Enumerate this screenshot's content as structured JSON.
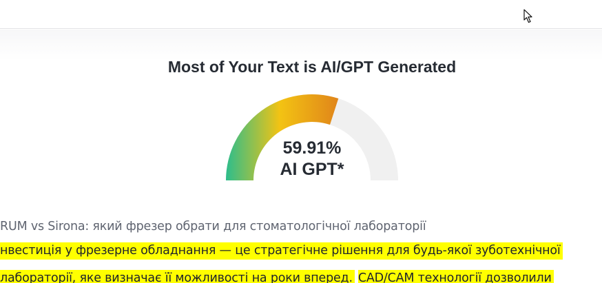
{
  "header": {
    "cursor_icon": "mouse-pointer-icon"
  },
  "result": {
    "headline": "Most of Your Text is AI/GPT Generated",
    "percent_text": "59.91%",
    "percent_value": 59.91,
    "label": "AI GPT*",
    "gauge_colors": {
      "start": "#2dbd8c",
      "middle": "#f3c313",
      "end": "#e0851a",
      "track": "#f0f0f0"
    }
  },
  "analyzed_text": {
    "title": "RUM vs Sirona: який фрезер обрати для стоматологічної лабораторії",
    "line1": "нвестиція у фрезерне обладнання — це стратегічне рішення для будь-якої зуботехнічної",
    "line2a": "лабораторії, яке визначає її можливості на роки вперед.",
    "line2b": "CAD/CAM технології дозволили",
    "highlight_color": "#ffff00"
  }
}
